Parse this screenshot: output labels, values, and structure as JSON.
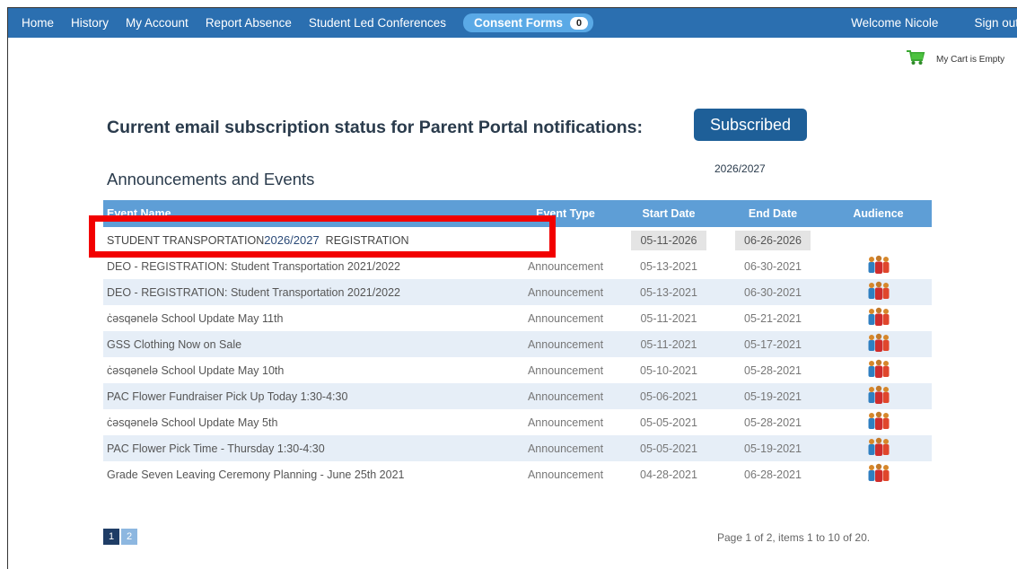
{
  "nav": {
    "items": [
      "Home",
      "History",
      "My Account",
      "Report Absence",
      "Student Led Conferences"
    ],
    "consent_label": "Consent Forms",
    "consent_count": "0",
    "welcome": "Welcome Nicole",
    "signout": "Sign out"
  },
  "cart": {
    "label": "My Cart is Empty"
  },
  "subscription": {
    "status_text": "Current email subscription status for Parent Portal notifications:",
    "status_value": "Subscribed"
  },
  "announcements": {
    "title": "Announcements and Events",
    "year_label": "2026/2027",
    "columns": [
      "Event Name",
      "Event Type",
      "Start Date",
      "End Date",
      "Audience"
    ],
    "first_row": {
      "name_prefix": "STUDENT TRANSPORTATION",
      "name_year": "2026/2027",
      "name_suffix": "REGISTRATION",
      "start": "05-11-2026",
      "end": "06-26-2026"
    },
    "rows": [
      {
        "name": "DEO - REGISTRATION: Student Transportation 2021/2022",
        "type": "Announcement",
        "start": "05-13-2021",
        "end": "06-30-2021"
      },
      {
        "name": "DEO - REGISTRATION: Student Transportation 2021/2022",
        "type": "Announcement",
        "start": "05-13-2021",
        "end": "06-30-2021"
      },
      {
        "name": "ċəsqənelə School Update May 11th",
        "type": "Announcement",
        "start": "05-11-2021",
        "end": "05-21-2021"
      },
      {
        "name": "GSS Clothing Now on Sale",
        "type": "Announcement",
        "start": "05-11-2021",
        "end": "05-17-2021"
      },
      {
        "name": "ċəsqənelə School Update May 10th",
        "type": "Announcement",
        "start": "05-10-2021",
        "end": "05-28-2021"
      },
      {
        "name": "PAC Flower Fundraiser Pick Up Today 1:30-4:30",
        "type": "Announcement",
        "start": "05-06-2021",
        "end": "05-19-2021"
      },
      {
        "name": "ċəsqənelə School Update May 5th",
        "type": "Announcement",
        "start": "05-05-2021",
        "end": "05-28-2021"
      },
      {
        "name": "PAC Flower Pick Time - Thursday 1:30-4:30",
        "type": "Announcement",
        "start": "05-05-2021",
        "end": "05-19-2021"
      },
      {
        "name": "Grade Seven Leaving Ceremony Planning - June 25th 2021",
        "type": "Announcement",
        "start": "04-28-2021",
        "end": "06-28-2021"
      }
    ],
    "audience_icon": "people-group-icon"
  },
  "pager": {
    "pages": [
      "1",
      "2"
    ],
    "info": "Page 1 of 2, items 1 to 10 of 20."
  },
  "colors": {
    "navbar": "#2b6fb0",
    "header": "#5e9ed6",
    "highlight": "#f20000",
    "button": "#1e5f98"
  }
}
